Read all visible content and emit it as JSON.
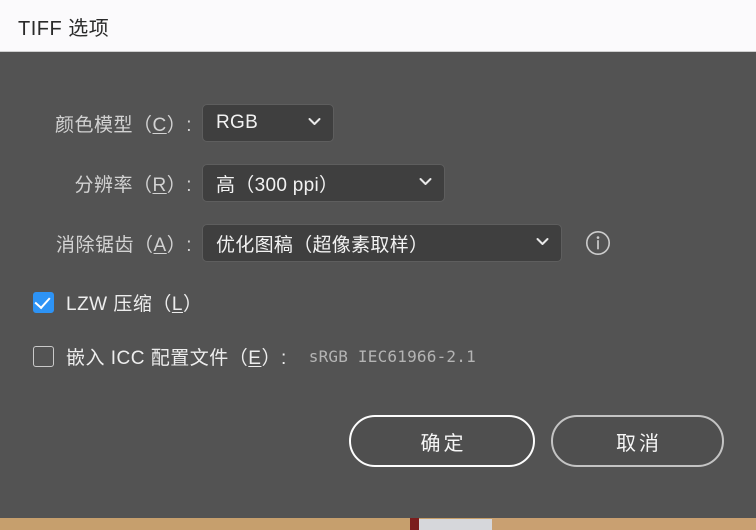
{
  "window": {
    "title": "TIFF 选项"
  },
  "form": {
    "color_model": {
      "label_prefix": "颜色模型（",
      "accel": "C",
      "label_suffix": "）:",
      "value": "RGB",
      "chevron_icon": "chevron-down-icon"
    },
    "resolution": {
      "label_prefix": "分辨率（",
      "accel": "R",
      "label_suffix": "）:",
      "value": "高（300 ppi）",
      "chevron_icon": "chevron-down-icon"
    },
    "anti_alias": {
      "label_prefix": "消除锯齿（",
      "accel": "A",
      "label_suffix": "）:",
      "value": "优化图稿（超像素取样）",
      "chevron_icon": "chevron-down-icon",
      "info_icon": "info-circle-icon"
    },
    "lzw_compression": {
      "checked": true,
      "label_prefix": "LZW 压缩（",
      "accel": "L",
      "label_suffix": "）"
    },
    "embed_icc": {
      "checked": false,
      "label_prefix": "嵌入 ICC 配置文件（",
      "accel": "E",
      "label_suffix": "）:",
      "value": "sRGB IEC61966-2.1"
    }
  },
  "buttons": {
    "ok": "确定",
    "cancel": "取消"
  },
  "colors": {
    "dialog_background": "#535353",
    "titlebar_background": "#fbfafc",
    "field_background": "#3f3f3f",
    "checkbox_accent": "#2d93f5",
    "label_text": "#d2d2d2",
    "value_text": "#f2f2f2"
  }
}
